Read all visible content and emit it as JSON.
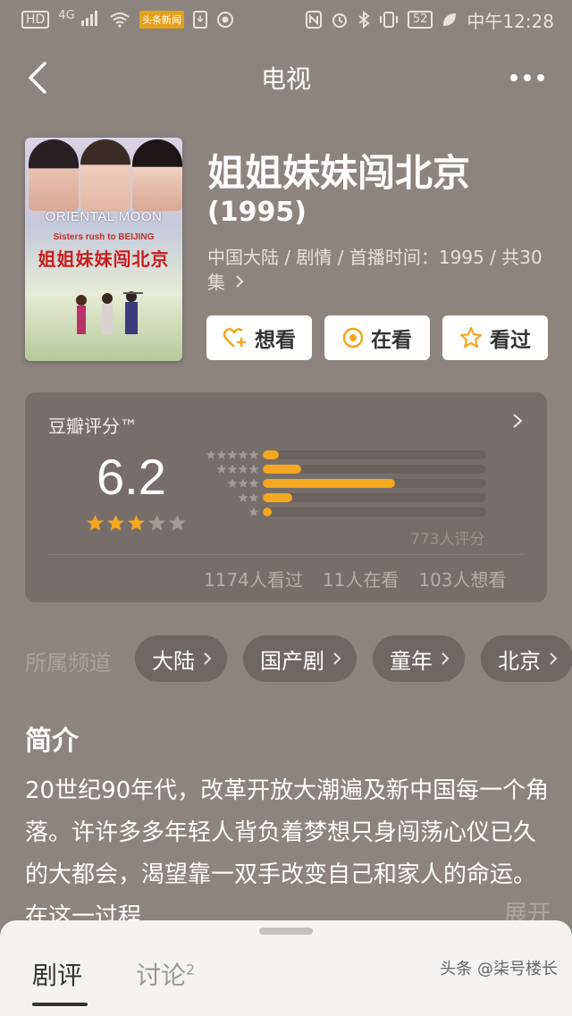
{
  "status_bar": {
    "network": "4G",
    "hd_chip": "HD",
    "news_icon_label": "头条新闻",
    "battery": "52",
    "time": "中午12:28"
  },
  "nav": {
    "title": "电视"
  },
  "poster": {
    "english_title": "ORIENTAL MOON",
    "subtitle": "Sisters rush to BEIJING",
    "chinese_title": "姐姐妹妹闯北京"
  },
  "show": {
    "title": "姐姐妹妹闯北京",
    "year": "(1995)",
    "meta": "中国大陆 / 剧情 / 首播时间：1995 / 共30集"
  },
  "actions": {
    "want_label": "想看",
    "watching_label": "在看",
    "watched_label": "看过"
  },
  "rating": {
    "label": "豆瓣评分™",
    "score": "6.2",
    "stars_filled": 3,
    "distribution_fraction": [
      0.07,
      0.17,
      0.59,
      0.13,
      0.04
    ],
    "count_text": "773人评分",
    "watched": "1174人看过",
    "watching": "11人在看",
    "want": "103人想看"
  },
  "channels": {
    "label": "所属频道",
    "items": [
      "大陆",
      "国产剧",
      "童年",
      "北京"
    ]
  },
  "intro": {
    "heading": "简介",
    "text": "20世纪90年代，改革开放大潮遍及新中国每一个角落。许许多多年轻人背负着梦想只身闯荡心仪已久的大都会，渴望靠一双手改变自己和家人的命运。在这一过程",
    "expand_label": "展开"
  },
  "bottom_sheet": {
    "tab_reviews": "剧评",
    "tab_discussion": "讨论",
    "discussion_count": "2"
  },
  "watermark": "头条 @柒号楼长",
  "colors": {
    "background": "#8d8480",
    "card": "#776e6b",
    "accent_star": "#f4a71f",
    "action_icon": "#f4a71f"
  }
}
